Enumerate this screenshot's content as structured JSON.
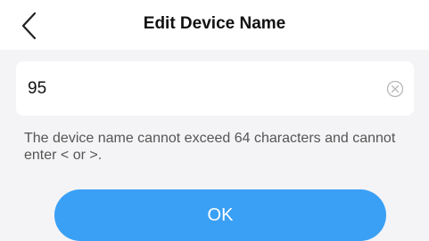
{
  "header": {
    "title": "Edit Device Name",
    "back_icon": "chevron-left-icon"
  },
  "name_field": {
    "value": "95",
    "clear_icon": "clear-circle-x-icon"
  },
  "hint": "The device name cannot exceed 64 characters and cannot enter < or >.",
  "ok_label": "OK",
  "colors": {
    "accent": "#3aa0f5",
    "page_background": "#f4f4f6",
    "card_background": "#ffffff"
  }
}
